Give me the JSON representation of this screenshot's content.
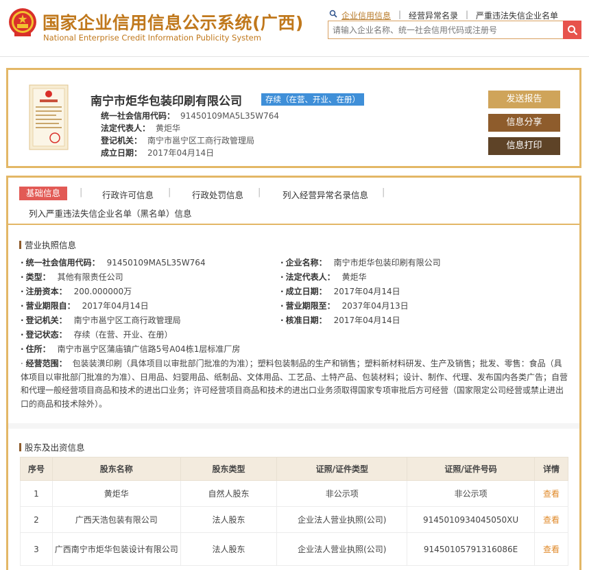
{
  "header": {
    "title_cn": "国家企业信用信息公示系统(广西)",
    "title_en": "National Enterprise Credit Information Publicity System",
    "links": [
      "企业信用信息",
      "经营异常名录",
      "严重违法失信企业名单"
    ],
    "search_placeholder": "请输入企业名称、统一社会信用代码或注册号",
    "colors": {
      "brand": "#c0781c",
      "search_button": "#e7534c"
    }
  },
  "company": {
    "name": "南宁市炬华包装印刷有限公司",
    "status": "存续（在营、开业、在册）",
    "credit_code_label": "统一社会信用代码：",
    "credit_code": "91450109MA5L35W764",
    "legal_rep_label": "法定代表人：",
    "legal_rep": "黄炬华",
    "authority_label": "登记机关：",
    "authority": "南宁市邕宁区工商行政管理局",
    "established_label": "成立日期：",
    "established": "2017年04月14日",
    "buttons": [
      "发送报告",
      "信息分享",
      "信息打印"
    ]
  },
  "tabs": [
    "基础信息",
    "行政许可信息",
    "行政处罚信息",
    "列入经营异常名录信息",
    "列入严重违法失信企业名单（黑名单）信息"
  ],
  "license_section": {
    "title": "营业执照信息",
    "fields": [
      {
        "label": "统一社会信用代码：",
        "value": "91450109MA5L35W764"
      },
      {
        "label": "企业名称：",
        "value": "南宁市炬华包装印刷有限公司"
      },
      {
        "label": "类型：",
        "value": "其他有限责任公司"
      },
      {
        "label": "法定代表人：",
        "value": "黄炬华"
      },
      {
        "label": "注册资本：",
        "value": "200.000000万"
      },
      {
        "label": "成立日期：",
        "value": "2017年04月14日"
      },
      {
        "label": "营业期限自：",
        "value": "2017年04月14日"
      },
      {
        "label": "营业期限至：",
        "value": "2037年04月13日"
      },
      {
        "label": "登记机关：",
        "value": "南宁市邕宁区工商行政管理局"
      },
      {
        "label": "核准日期：",
        "value": "2017年04月14日"
      },
      {
        "label": "登记状态：",
        "value": "存续（在营、开业、在册）"
      },
      {
        "label": "住所：",
        "value": "南宁市邕宁区蒲庙镇广信路5号A04栋1层标准厂房"
      }
    ],
    "scope_label": "经营范围：",
    "scope": "包装装潢印刷（具体项目以审批部门批准的为准）；塑料包装制品的生产和销售；塑料新材料研发、生产及销售；批发、零售：食品（具体项目以审批部门批准的为准）、日用品、妇婴用品、纸制品、文体用品、工艺品、土特产品、包装材料；设计、制作、代理、发布国内各类广告；自营和代理一般经营项目商品和技术的进出口业务；许可经营项目商品和技术的进出口业务须取得国家专项审批后方可经营（国家限定公司经营或禁止进出口的商品和技术除外）。"
  },
  "shareholders": {
    "title": "股东及出资信息",
    "columns": [
      "序号",
      "股东名称",
      "股东类型",
      "证照/证件类型",
      "证照/证件号码",
      "详情"
    ],
    "rows": [
      {
        "no": "1",
        "name": "黄炬华",
        "type": "自然人股东",
        "cert_type": "非公示项",
        "cert_no": "非公示项",
        "detail": "查看"
      },
      {
        "no": "2",
        "name": "广西天浩包装有限公司",
        "type": "法人股东",
        "cert_type": "企业法人营业执照(公司)",
        "cert_no": "9145010934045050XU",
        "detail": "查看"
      },
      {
        "no": "3",
        "name": "广西南宁市炬华包装设计有限公司",
        "type": "法人股东",
        "cert_type": "企业法人营业执照(公司)",
        "cert_no": "91450105791316086E",
        "detail": "查看"
      }
    ]
  }
}
